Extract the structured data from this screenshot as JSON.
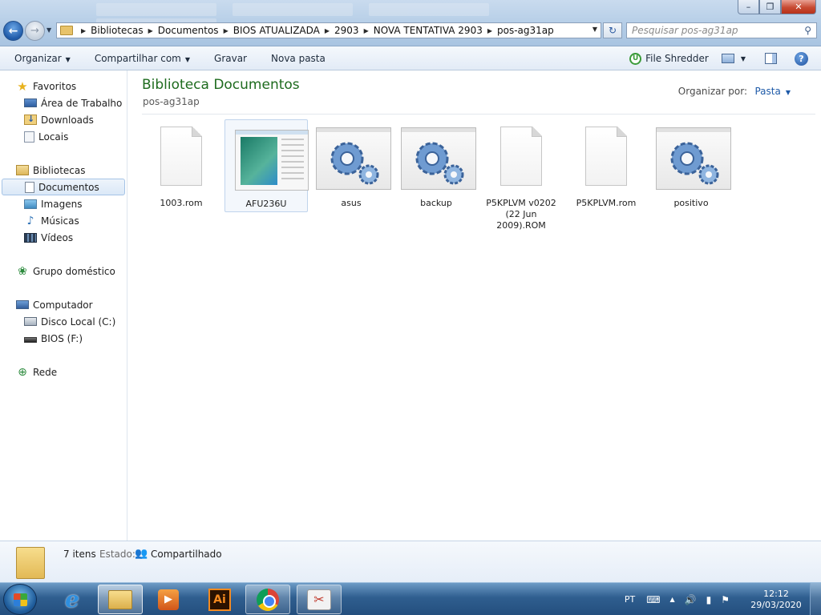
{
  "window": {
    "minimize_glyph": "–",
    "maximize_glyph": "❐",
    "close_glyph": "✕"
  },
  "nav": {
    "back_glyph": "←",
    "forward_glyph": "→",
    "recent_glyph": "▼",
    "breadcrumbs": [
      "Bibliotecas",
      "Documentos",
      "BIOS ATUALIZADA",
      "2903",
      "NOVA TENTATIVA 2903",
      "pos-ag31ap"
    ],
    "separator_glyph": "▶",
    "dropdown_glyph": "▼",
    "refresh_glyph": "↻",
    "search_placeholder": "Pesquisar pos-ag31ap",
    "search_icon_glyph": "⚲"
  },
  "toolbar": {
    "organize_label": "Organizar",
    "share_label": "Compartilhar com",
    "burn_label": "Gravar",
    "new_folder_label": "Nova pasta",
    "file_shredder_label": "File Shredder",
    "file_shredder_icon_glyph": "U",
    "caret_glyph": "▼",
    "help_glyph": "?"
  },
  "sidebar": {
    "favorites": {
      "label": "Favoritos",
      "icon": "star-icon"
    },
    "favorites_items": [
      {
        "label": "Área de Trabalho",
        "icon": "desktop-icon"
      },
      {
        "label": "Downloads",
        "icon": "downloads-icon"
      },
      {
        "label": "Locais",
        "icon": "recent-places-icon"
      }
    ],
    "libraries": {
      "label": "Bibliotecas",
      "icon": "library-icon"
    },
    "libraries_items": [
      {
        "label": "Documentos",
        "icon": "documents-icon",
        "selected": true
      },
      {
        "label": "Imagens",
        "icon": "pictures-icon"
      },
      {
        "label": "Músicas",
        "icon": "music-icon"
      },
      {
        "label": "Vídeos",
        "icon": "videos-icon"
      }
    ],
    "homegroup": {
      "label": "Grupo doméstico",
      "icon": "homegroup-icon"
    },
    "computer": {
      "label": "Computador",
      "icon": "computer-icon"
    },
    "computer_items": [
      {
        "label": "Disco Local (C:)",
        "icon": "hard-drive-icon"
      },
      {
        "label": "BIOS (F:)",
        "icon": "usb-drive-icon"
      }
    ],
    "network": {
      "label": "Rede",
      "icon": "network-icon"
    }
  },
  "content": {
    "title": "Biblioteca Documentos",
    "subtitle": "pos-ag31ap",
    "arrange_label": "Organizar por:",
    "arrange_value": "Pasta",
    "items": [
      {
        "name": "1003.rom",
        "icon": "file-icon"
      },
      {
        "name": "AFU236U",
        "icon": "application-window-icon",
        "selected": true
      },
      {
        "name": "asus",
        "icon": "gears-icon"
      },
      {
        "name": "backup",
        "icon": "gears-icon"
      },
      {
        "name": "P5KPLVM v0202 (22 Jun 2009).ROM",
        "icon": "file-icon"
      },
      {
        "name": "P5KPLVM.rom",
        "icon": "file-icon"
      },
      {
        "name": "positivo",
        "icon": "gears-icon"
      }
    ]
  },
  "details": {
    "count": "7 itens",
    "state_label": "Estado:",
    "state_value": "Compartilhado"
  },
  "taskbar": {
    "apps": [
      "internet-explorer-icon",
      "windows-explorer-icon",
      "media-player-icon",
      "illustrator-icon",
      "chrome-icon",
      "file-shredder-icon"
    ],
    "illustrator_glyph": "Ai",
    "media_glyph": "▶",
    "ie_glyph": "e",
    "shredder_glyph": "✂",
    "language": "PT",
    "time": "12:12",
    "date": "29/03/2020",
    "tray_up_glyph": "▲",
    "volume_glyph": "🔊",
    "network_glyph": "▮",
    "flag_glyph": "⚑"
  }
}
